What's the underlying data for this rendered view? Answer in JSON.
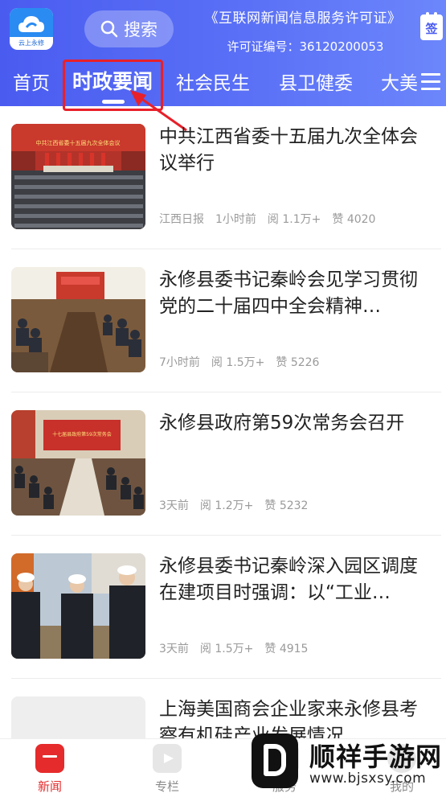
{
  "app": {
    "logo_text": "云上永修",
    "search_label": "搜索",
    "license_title": "《互联网新闻信息服务许可证》",
    "license_number": "许可证编号：36120200053",
    "sign_label": "签"
  },
  "tabs": [
    {
      "label": "首页"
    },
    {
      "label": "时政要闻",
      "active": true
    },
    {
      "label": "社会民生"
    },
    {
      "label": "县卫健委"
    },
    {
      "label": "大美"
    }
  ],
  "news": [
    {
      "title": "中共江西省委十五届九次全体会议举行",
      "source": "江西日报",
      "time": "1小时前",
      "reads": "阅 1.1万+",
      "likes": "赞 4020",
      "image_banner": "中共江西省委十五届九次全体会议"
    },
    {
      "title": "永修县委书记秦岭会见学习贯彻党的二十届四中全会精神…",
      "source": "",
      "time": "7小时前",
      "reads": "阅 1.5万+",
      "likes": "赞 5226",
      "image_banner": ""
    },
    {
      "title": "永修县政府第59次常务会召开",
      "source": "",
      "time": "3天前",
      "reads": "阅 1.2万+",
      "likes": "赞 5232",
      "image_banner": "十七届县政府第59次常务会"
    },
    {
      "title": "永修县委书记秦岭深入园区调度在建项目时强调：以“工业…",
      "source": "",
      "time": "3天前",
      "reads": "阅 1.5万+",
      "likes": "赞 4915",
      "image_banner": ""
    },
    {
      "title": "上海美国商会企业家来永修县考察有机硅产业发展情况",
      "source": "",
      "time": "",
      "reads": "",
      "likes": "",
      "image_banner": ""
    }
  ],
  "bottom_nav": [
    {
      "label": "新闻",
      "icon": "news-icon",
      "active": true
    },
    {
      "label": "专栏",
      "icon": "column-icon"
    },
    {
      "label": "服务",
      "icon": "service-icon"
    },
    {
      "label": "我的",
      "icon": "profile-icon"
    }
  ],
  "watermark": {
    "title": "顺祥手游网",
    "url": "www.bjsxsy.com"
  },
  "colors": {
    "header_start": "#4a5cf0",
    "header_end": "#6c86fb",
    "annotation_red": "#e8202a",
    "active_nav_red": "#e52b2b"
  }
}
